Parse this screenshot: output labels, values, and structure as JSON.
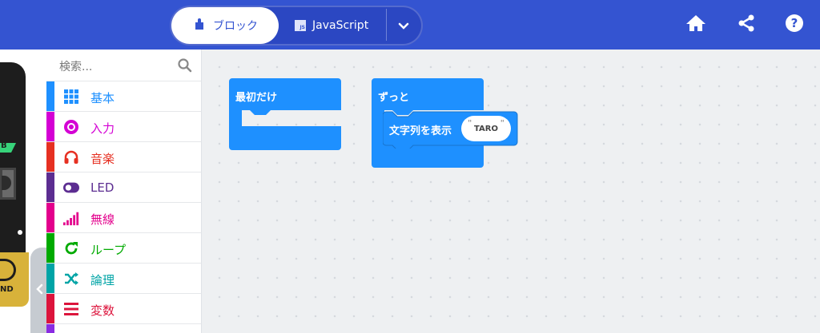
{
  "header": {
    "mode_blocks_label": "ブロック",
    "mode_js_label": "JavaScript",
    "js_icon_text": "JS"
  },
  "simulator": {
    "pin_label": "B",
    "gnd_label": "ND"
  },
  "toolbox": {
    "search_placeholder": "検索...",
    "categories": [
      {
        "label": "基本",
        "color": "#1e90ff",
        "icon": "grid-icon"
      },
      {
        "label": "入力",
        "color": "#d400d4",
        "icon": "target-icon"
      },
      {
        "label": "音楽",
        "color": "#e63022",
        "icon": "headphones-icon"
      },
      {
        "label": "LED",
        "color": "#5c2d91",
        "icon": "toggle-icon"
      },
      {
        "label": "無線",
        "color": "#e3008c",
        "icon": "signal-bars-icon"
      },
      {
        "label": "ループ",
        "color": "#00aa00",
        "icon": "refresh-icon"
      },
      {
        "label": "論理",
        "color": "#00a4a6",
        "icon": "shuffle-icon"
      },
      {
        "label": "変数",
        "color": "#dc143c",
        "icon": "list-icon"
      }
    ]
  },
  "workspace": {
    "on_start_label": "最初だけ",
    "forever_label": "ずっと",
    "show_string_label": "文字列を表示",
    "string_value": "TARO",
    "block_color": "#1e90ff"
  }
}
